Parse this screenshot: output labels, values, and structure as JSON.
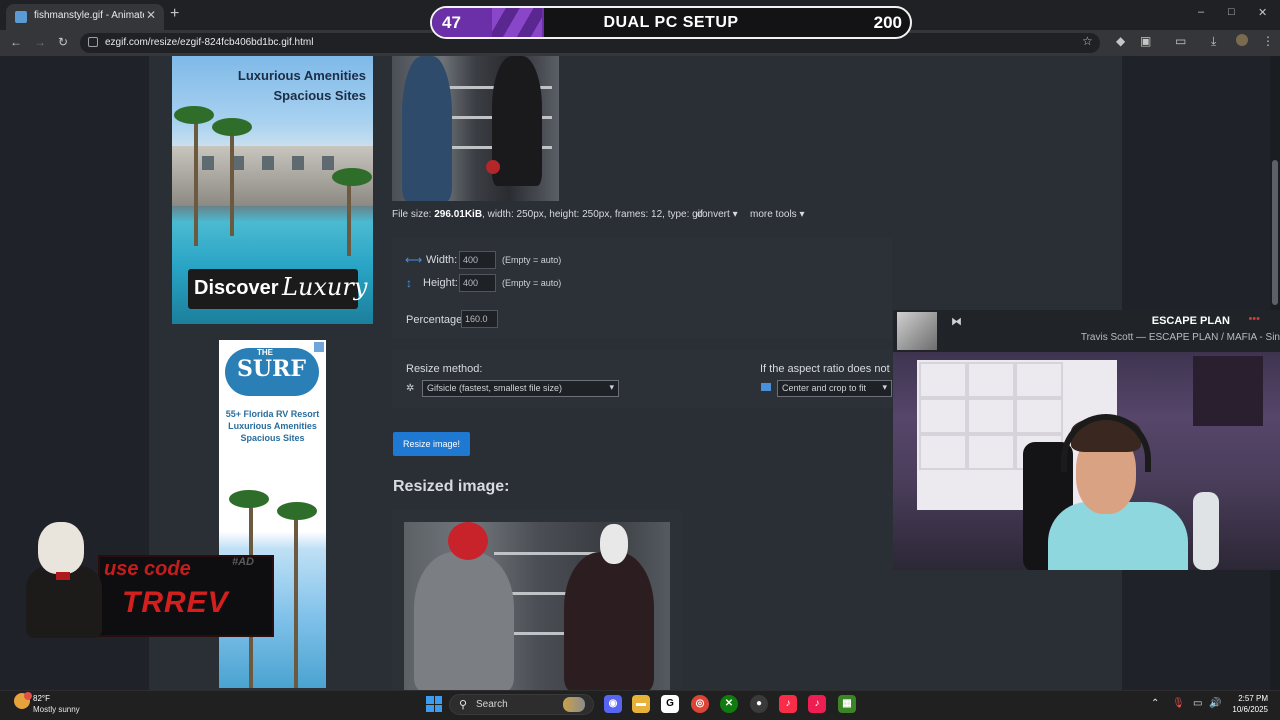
{
  "browser": {
    "tab_title": "fishmanstyle.gif - Animated im",
    "tab_close": "✕",
    "new_tab": "+",
    "url": "ezgif.com/resize/ezgif-824fcb406bd1bc.gif.html",
    "window_controls": {
      "minimize": "–",
      "maximize": "□",
      "close": "✕"
    },
    "nav": {
      "back": "←",
      "forward": "→",
      "reload": "↻"
    }
  },
  "overlay": {
    "left_count": "47",
    "title": "DUAL PC SETUP",
    "right_count": "200"
  },
  "ad1": {
    "line1": "Luxurious Amenities",
    "line2": "Spacious Sites",
    "discover": "Discover",
    "luxury": "Luxury"
  },
  "ad2": {
    "the": "THE",
    "surf": "SURF",
    "line1": "55+ Florida RV Resort",
    "line2": "Luxurious Amenities",
    "line3": "Spacious Sites"
  },
  "file_info": {
    "label": "File size: ",
    "size": "296.01KiB",
    "rest": ", width: 250px, height: 250px, frames: 12, type: gif"
  },
  "dropdowns": {
    "convert": "convert ▾",
    "more_tools": "more tools ▾"
  },
  "form": {
    "width_label": "Width:",
    "width_value": "400",
    "width_hint": "(Empty = auto)",
    "height_label": "Height:",
    "height_value": "400",
    "height_hint": "(Empty = auto)",
    "percentage_label": "Percentage:",
    "percentage_value": "160.0",
    "resize_method_label": "Resize method:",
    "resize_method_value": "Gifsicle (fastest, smallest file size)",
    "aspect_label": "If the aspect ratio does not ma",
    "aspect_value": "Center and crop to fit",
    "resize_button": "Resize image!",
    "resized_title": "Resized image:"
  },
  "sponsor": {
    "line1": "use code",
    "line2": "TRREV",
    "tag": "#AD"
  },
  "music": {
    "song": "ESCAPE PLAN",
    "artist": "Travis Scott — ESCAPE PLAN / MAFIA - Sin",
    "more": "•••"
  },
  "taskbar": {
    "temperature": "82°F",
    "condition": "Mostly sunny",
    "search_label": "Search",
    "time": "2:57 PM",
    "date": "10/6/2025"
  },
  "colors": {
    "accent_button": "#1f78d1",
    "overlay_purple": "#6b2fa8",
    "sponsor_red": "#c41d1d",
    "page_bg": "#1f2329",
    "content_bg": "#2a2e35"
  }
}
